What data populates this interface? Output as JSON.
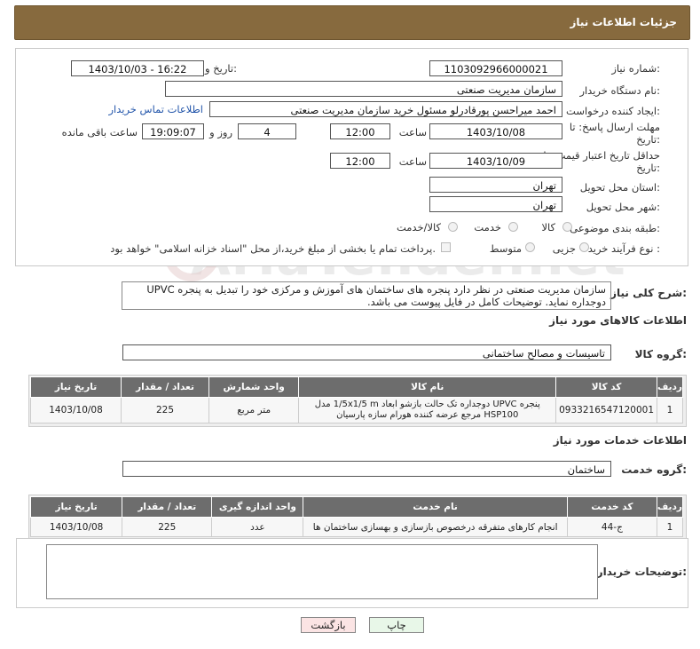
{
  "header": {
    "title": "جزئیات اطلاعات نیاز"
  },
  "watermark": "AriaTender.net",
  "fields": {
    "need_number_label": "شماره نیاز:",
    "need_number": "1103092966000021",
    "announce_label": "تاریخ و ساعت اعلان عمومی:",
    "announce_value": "1403/10/03 - 16:22",
    "buyer_org_label": "نام دستگاه خریدار:",
    "buyer_org": "سازمان مدیریت صنعتی",
    "creator_label": "ایجاد کننده درخواست:",
    "creator": "احمد میراحسن پورقادرلو مسئول خرید سازمان مدیریت صنعتی",
    "contact_link": "اطلاعات تماس خریدار",
    "deadline_label_1": "مهلت ارسال پاسخ: تا",
    "deadline_label_2": "تاریخ:",
    "deadline_date": "1403/10/08",
    "time_label": "ساعت",
    "deadline_time": "12:00",
    "days_value": "4",
    "days_label": "روز و",
    "remaining_time": "19:09:07",
    "remaining_label": "ساعت باقی مانده",
    "validity_label_1": "حداقل تاریخ اعتبار قیمت: تا",
    "validity_label_2": "تاریخ:",
    "validity_date": "1403/10/09",
    "validity_time": "12:00",
    "province_label": "استان محل تحویل:",
    "province": "تهران",
    "city_label": "شهر محل تحویل:",
    "city": "تهران",
    "category_label": "طبقه بندی موضوعی:",
    "category_options": [
      "کالا",
      "خدمت",
      "کالا/خدمت"
    ],
    "purchase_type_label": "نوع فرآیند خرید :",
    "purchase_options": [
      "جزیی",
      "متوسط"
    ],
    "payment_note": "پرداخت تمام یا بخشی از مبلغ خرید،از محل \"اسناد خزانه اسلامی\" خواهد بود."
  },
  "description": {
    "label": "شرح کلی نیاز:",
    "text": "سازمان مدیریت صنعتی در نظر دارد پنجره های ساختمان های آموزش و مرکزی خود را تبدیل به پنجره UPVC دوجداره نماید. توضیحات کامل در فایل پیوست می باشد."
  },
  "goods": {
    "section_title": "اطلاعات کالاهای مورد نیاز",
    "group_label": "گروه کالا:",
    "group_value": "تاسیسات و مصالح ساختمانی",
    "columns": [
      "ردیف",
      "کد کالا",
      "نام کالا",
      "واحد شمارش",
      "تعداد / مقدار",
      "تاریخ نیاز"
    ],
    "rows": [
      {
        "row": "1",
        "code": "0933216547120001",
        "name": "پنجره UPVC دوجداره تک حالت بازشو ابعاد 1/5x1/5 m مدل HSP100 مرجع عرضه کننده هورام سازه پارسیان",
        "unit": "متر مربع",
        "qty": "225",
        "date": "1403/10/08"
      }
    ]
  },
  "services": {
    "section_title": "اطلاعات خدمات مورد نیاز",
    "group_label": "گروه خدمت:",
    "group_value": "ساختمان",
    "columns": [
      "ردیف",
      "کد خدمت",
      "نام خدمت",
      "واحد اندازه گیری",
      "تعداد / مقدار",
      "تاریخ نیاز"
    ],
    "rows": [
      {
        "row": "1",
        "code": "ج-44",
        "name": "انجام کارهای متفرقه درخصوص بازسازی و بهسازی ساختمان ها",
        "unit": "عدد",
        "qty": "225",
        "date": "1403/10/08"
      }
    ]
  },
  "buyer_notes": {
    "label": "توضیحات خریدار:",
    "value": ""
  },
  "buttons": {
    "print": "چاپ",
    "back": "بازگشت"
  },
  "colors": {
    "header_bg": "#876a3e",
    "table_header": "#6d6d6d",
    "print_bg": "#e8f7e8",
    "back_bg": "#fbe4e4"
  }
}
